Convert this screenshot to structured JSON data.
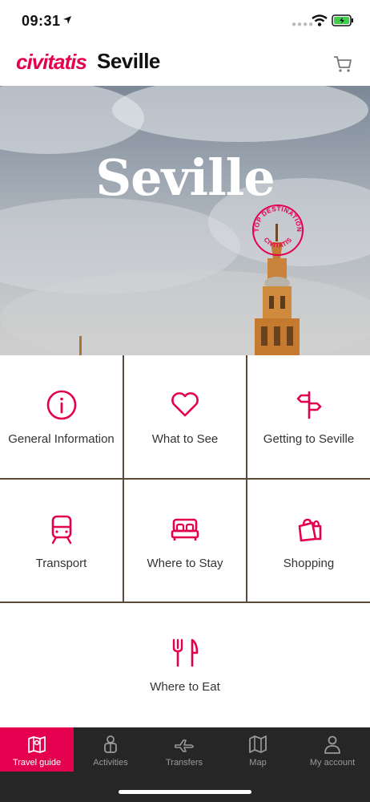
{
  "status": {
    "time": "09:31"
  },
  "header": {
    "brand": "civitatis",
    "city": "Seville"
  },
  "hero": {
    "title": "Seville",
    "badge_top": "TOP DESTINATION",
    "badge_bottom": "CIVITATIS"
  },
  "menu": [
    {
      "label": "General Information",
      "icon": "info-icon"
    },
    {
      "label": "What to See",
      "icon": "heart-icon"
    },
    {
      "label": "Getting to Seville",
      "icon": "signpost-icon"
    },
    {
      "label": "Transport",
      "icon": "train-icon"
    },
    {
      "label": "Where to Stay",
      "icon": "bed-icon"
    },
    {
      "label": "Shopping",
      "icon": "shopping-bag-icon"
    },
    {
      "label": "Where to Eat",
      "icon": "fork-knife-icon"
    }
  ],
  "nav": [
    {
      "label": "Travel guide",
      "icon": "map-book-icon",
      "active": true
    },
    {
      "label": "Activities",
      "icon": "activities-icon",
      "active": false
    },
    {
      "label": "Transfers",
      "icon": "plane-icon",
      "active": false
    },
    {
      "label": "Map",
      "icon": "map-icon",
      "active": false
    },
    {
      "label": "My account",
      "icon": "user-icon",
      "active": false
    }
  ],
  "colors": {
    "accent": "#e5004f",
    "nav_bg": "#262626"
  }
}
